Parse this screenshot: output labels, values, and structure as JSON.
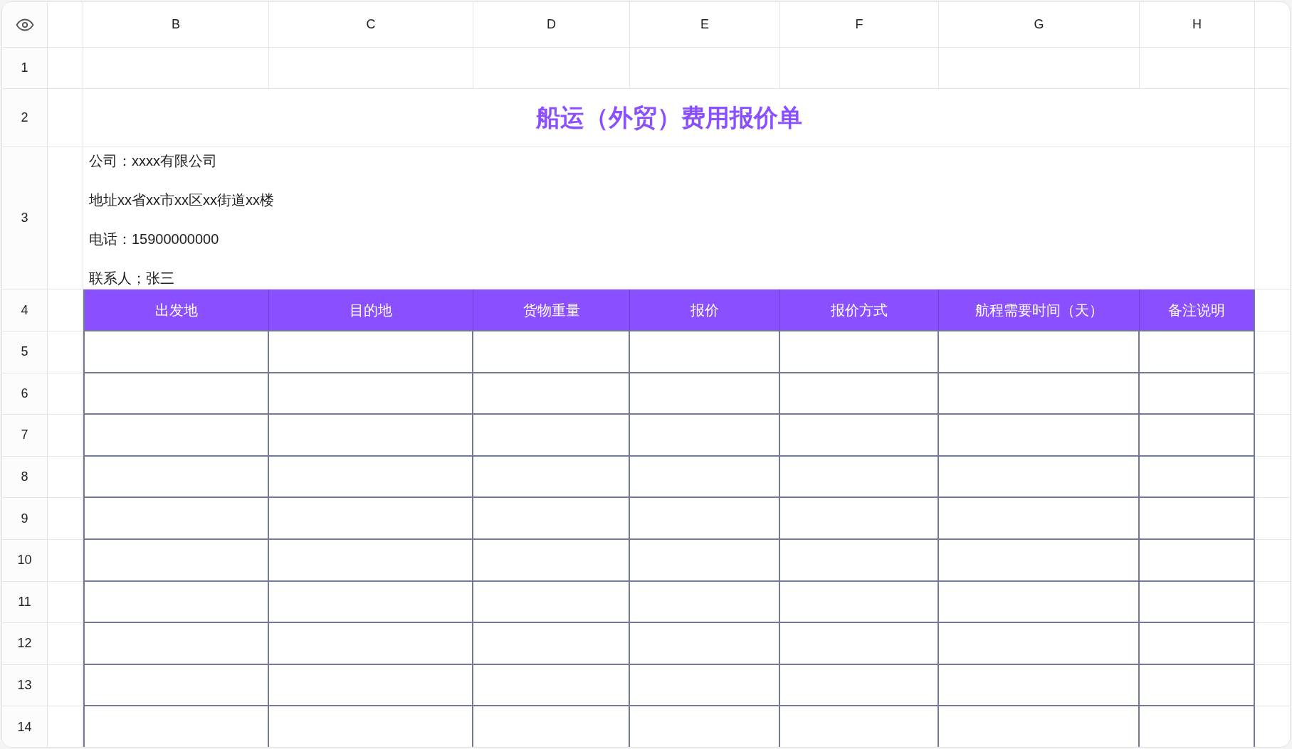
{
  "column_headers": [
    "B",
    "C",
    "D",
    "E",
    "F",
    "G",
    "H"
  ],
  "row_numbers": [
    "1",
    "2",
    "3",
    "4",
    "5",
    "6",
    "7",
    "8",
    "9",
    "10",
    "11",
    "12",
    "13",
    "14"
  ],
  "title": "船运（外贸）费用报价单",
  "info_lines": [
    "公司：xxxx有限公司",
    "地址xx省xx市xx区xx街道xx楼",
    "电话：15900000000",
    "联系人；张三"
  ],
  "table_headers": [
    "出发地",
    "目的地",
    "货物重量",
    "报价",
    "报价方式",
    "航程需要时间（天）",
    "备注说明"
  ]
}
